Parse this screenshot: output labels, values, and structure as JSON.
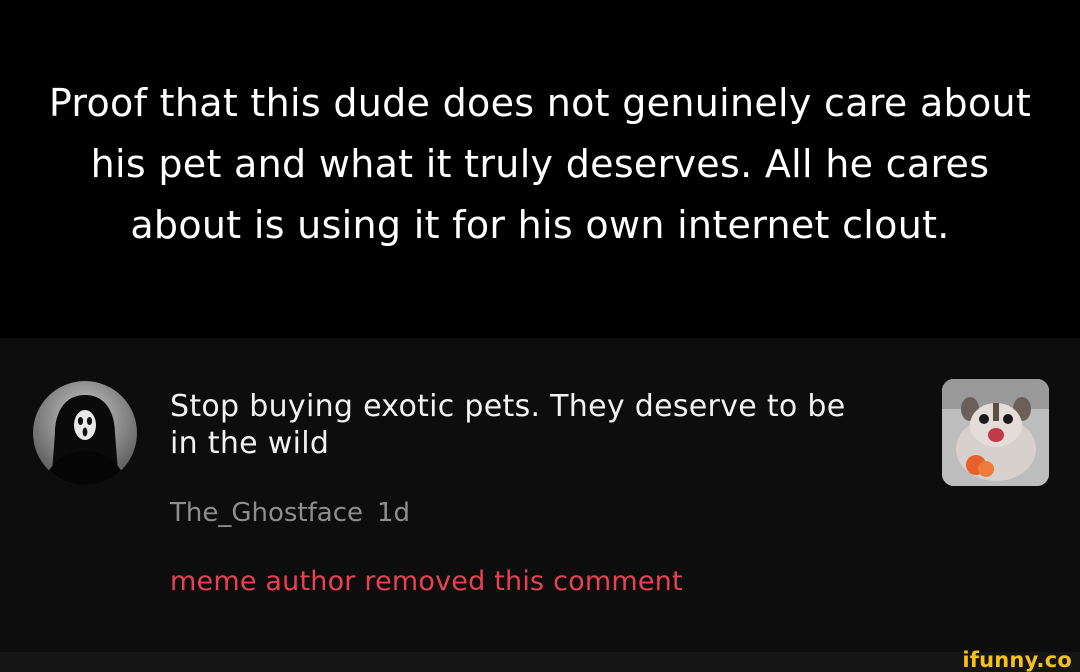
{
  "caption": {
    "text": "Proof that this dude does not genuinely care about his pet and what it truly deserves. All he cares about is using it for his own internet clout."
  },
  "comment": {
    "text": "Stop buying exotic pets. They deserve to be in the wild",
    "author": "The_Ghostface",
    "time": "1d",
    "removed_note": "meme author removed this comment",
    "avatar_icon": "ghostface-avatar-icon",
    "thumbnail_icon": "sugar-glider-thumbnail"
  },
  "watermark": {
    "text": "ifunny.co",
    "color": "#f4c21a"
  },
  "colors": {
    "background": "#000000",
    "comment_panel": "#0d0d0d",
    "removed_note": "#e8414f",
    "meta_text": "#8e8e8e"
  }
}
